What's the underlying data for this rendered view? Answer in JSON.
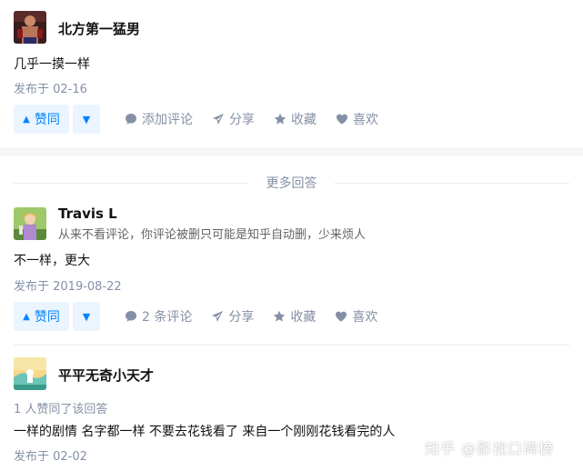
{
  "answers": [
    {
      "author": "北方第一猛男",
      "content": "几乎一摸一样",
      "meta": "发布于 02-16",
      "vote_label": "赞同",
      "actions": {
        "comment": "添加评论",
        "share": "分享",
        "collect": "收藏",
        "like": "喜欢"
      }
    },
    {
      "author": "Travis L",
      "bio": "从来不看评论，你评论被删只可能是知乎自动删，少来烦人",
      "content": "不一样，更大",
      "meta": "发布于 2019-08-22",
      "vote_label": "赞同",
      "actions": {
        "comment": "2 条评论",
        "share": "分享",
        "collect": "收藏",
        "like": "喜欢"
      }
    },
    {
      "author": "平平无奇小天才",
      "vote_info": "1 人赞同了该回答",
      "content": "一样的剧情 名字都一样 不要去花钱看了 来自一个刚刚花钱看完的人",
      "meta": "发布于 02-02"
    }
  ],
  "more_answers_label": "更多回答",
  "watermark": "知乎 @影视口碑榜",
  "colors": {
    "accent": "#0084ff",
    "accent_bg": "#ebf5ff",
    "muted": "#8590a6"
  },
  "icons": {
    "vote_up": "triangle-up-icon",
    "vote_down": "triangle-down-icon",
    "comment": "comment-bubble-icon",
    "share": "paper-plane-icon",
    "collect": "star-icon",
    "like": "heart-icon"
  }
}
